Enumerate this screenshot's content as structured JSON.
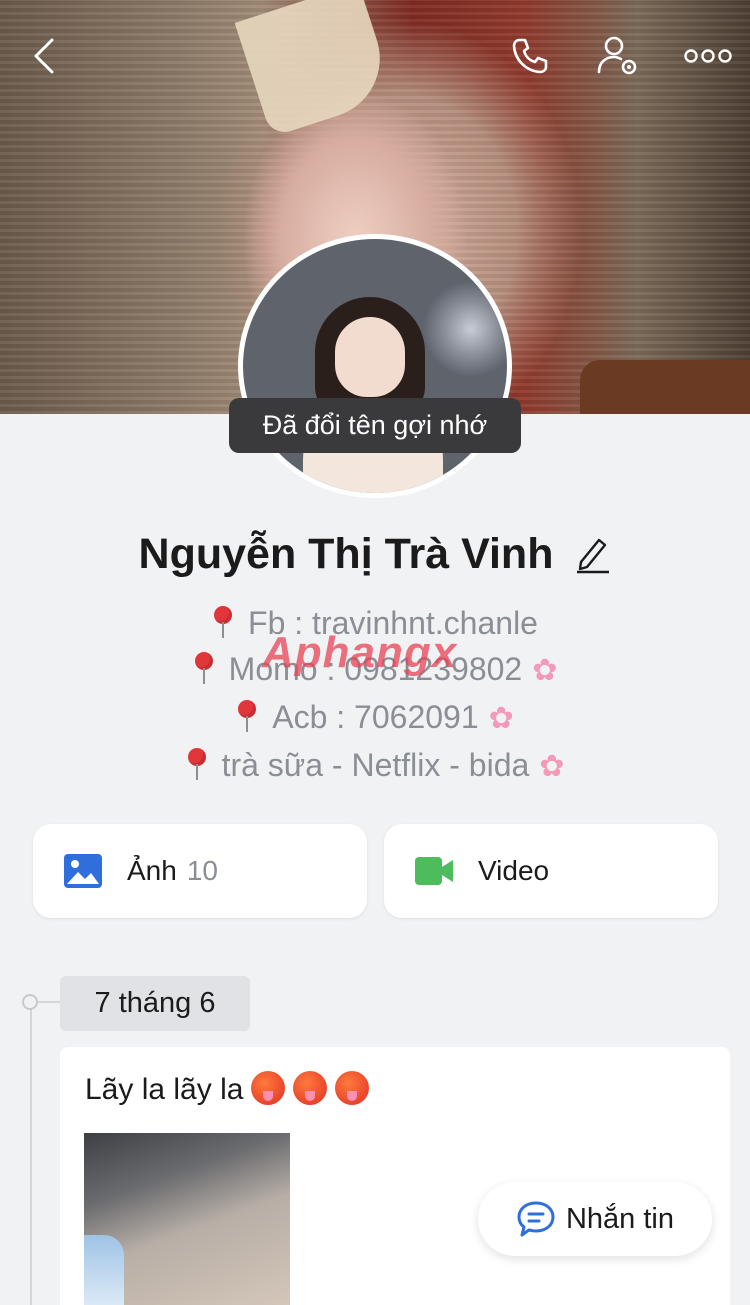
{
  "header": {
    "back_icon": "chevron-left-icon",
    "call_icon": "phone-icon",
    "settings_icon": "user-gear-icon",
    "more_icon": "more-dots-icon"
  },
  "profile": {
    "tooltip": "Đã đổi tên gợi nhớ",
    "name": "Nguyễn Thị Trà Vinh",
    "edit_icon": "pencil-icon",
    "bio": [
      {
        "text": "Fb : travinhnt.chanle",
        "flower": false
      },
      {
        "text": "Momo : 0981239802",
        "flower": true
      },
      {
        "text": "Acb : 7062091",
        "flower": true
      },
      {
        "text": "trà sữa - Netflix - bida",
        "flower": true
      }
    ],
    "watermark": "Aphangx"
  },
  "media": {
    "photos_label": "Ảnh",
    "photos_count": "10",
    "video_label": "Video",
    "colors": {
      "photo": "#2f6fdc",
      "video": "#4cbc5c"
    }
  },
  "timeline": {
    "date": "7 tháng 6",
    "post_text": "Lãy la lãy la"
  },
  "message_button": {
    "label": "Nhắn tin",
    "icon": "chat-bubble-icon",
    "color": "#2f6fdc"
  }
}
